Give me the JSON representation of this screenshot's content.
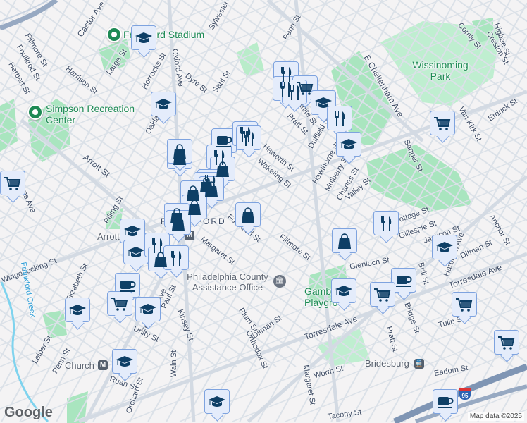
{
  "colors": {
    "background": "#f4f3f4",
    "park": "#a9e5bf",
    "road": "#dbe1e8",
    "highway": "#97a9c2",
    "marker_fill": "#e4ecfb",
    "marker_border": "#7ea3df",
    "icon": "#0e3f66",
    "poi_text": "#1e8a55"
  },
  "pois": {
    "stadium": "Frankford Stadium",
    "simpson": "Simpson Recreation Center",
    "wissinoming": "Wissinoming Park",
    "philadelphia_county": "Philadelphia County Assistance Office",
    "gambrel": "Gambrel Playground",
    "frankford": "FRANKFORD",
    "arrott": "Arrott",
    "church": "Church",
    "bridesburg": "Bridesburg",
    "frankford_creek": "Frankford Creek"
  },
  "streets": [
    "Castor Ave",
    "Sylvester St",
    "Penn St",
    "Comly St",
    "Higbee St",
    "Creston St",
    "Fillmore St",
    "Foulkrod St",
    "Herbert St",
    "Harrison St",
    "Large St",
    "Horrocks St",
    "Oxford Ave",
    "Dyre St",
    "Saul St",
    "Wakeling St",
    "Haworth St",
    "Pratt St",
    "Granite St",
    "Duffield St",
    "Hawthorne St",
    "Mulberry St",
    "Charles St",
    "Valley St",
    "E Cheltenham Ave",
    "Van Kirk St",
    "Erdrick St",
    "Sanger St",
    "Arrott St",
    "Pilling St",
    "Adams Ave",
    "Margaret St",
    "Oakland St",
    "Cottage St",
    "Gillespie St",
    "Jackson St",
    "Anchor St",
    "Ditman St",
    "Glenloch St",
    "Brill St",
    "Harbison Ave",
    "Torresdale Ave",
    "Tulip St",
    "Bridge St",
    "Plum St",
    "Orthodox St",
    "Wingohocking St",
    "Elizabeth St",
    "Frankford Ave",
    "Paul St",
    "Kinsey St",
    "Unity St",
    "Leiper St",
    "Waln St",
    "Ruan St",
    "Orchard St",
    "Worth St",
    "Eadom St",
    "Tacony St"
  ],
  "markers": [
    "school",
    "school",
    "shopping",
    "shopping",
    "coffee",
    "restaurant",
    "restaurant",
    "restaurant",
    "shopping",
    "restaurant",
    "shopping",
    "shopping",
    "shopping",
    "shopping",
    "shopping",
    "shopping",
    "shopping",
    "shopping",
    "school",
    "school",
    "restaurant",
    "shopping",
    "restaurant",
    "coffee",
    "grocery",
    "school",
    "school",
    "school",
    "school",
    "grocery",
    "restaurant",
    "restaurant",
    "grocery",
    "restaurant",
    "school",
    "restaurant",
    "school",
    "grocery",
    "shopping",
    "restaurant",
    "school",
    "coffee",
    "grocery",
    "school",
    "grocery",
    "grocery",
    "coffee"
  ],
  "interstate": "95",
  "google_logo": "Google",
  "attribution": "Map data ©2025"
}
